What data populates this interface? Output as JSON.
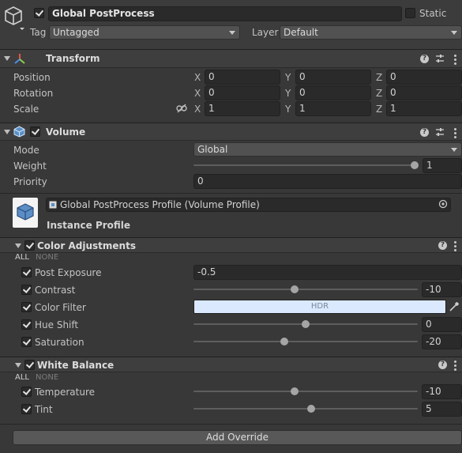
{
  "gameobject": {
    "name": "Global PostProcess",
    "active": true,
    "static_label": "Static",
    "tag_label": "Tag",
    "tag_value": "Untagged",
    "layer_label": "Layer",
    "layer_value": "Default"
  },
  "transform": {
    "title": "Transform",
    "rows": [
      {
        "label": "Position",
        "x": "0",
        "y": "0",
        "z": "0"
      },
      {
        "label": "Rotation",
        "x": "0",
        "y": "0",
        "z": "0"
      },
      {
        "label": "Scale",
        "x": "1",
        "y": "1",
        "z": "1"
      }
    ],
    "axis_x": "X",
    "axis_y": "Y",
    "axis_z": "Z"
  },
  "volume": {
    "title": "Volume",
    "enabled": true,
    "mode_label": "Mode",
    "mode_value": "Global",
    "weight_label": "Weight",
    "weight_value": "1",
    "weight_fraction": 1.0,
    "priority_label": "Priority",
    "priority_value": "0",
    "profile_value": "Global PostProcess  Profile (Volume Profile)",
    "instance_profile_label": "Instance Profile"
  },
  "color_adjustments": {
    "title": "Color Adjustments",
    "all_label": "ALL",
    "none_label": "NONE",
    "post_exposure_label": "Post Exposure",
    "post_exposure_value": "-0.5",
    "contrast_label": "Contrast",
    "contrast_value": "-10",
    "contrast_fraction": 0.45,
    "color_filter_label": "Color Filter",
    "color_filter_hdr": "HDR",
    "color_filter_color": "#dbe9ff",
    "hue_shift_label": "Hue Shift",
    "hue_shift_value": "0",
    "hue_shift_fraction": 0.5,
    "saturation_label": "Saturation",
    "saturation_value": "-20",
    "saturation_fraction": 0.4
  },
  "white_balance": {
    "title": "White Balance",
    "all_label": "ALL",
    "none_label": "NONE",
    "temperature_label": "Temperature",
    "temperature_value": "-10",
    "temperature_fraction": 0.45,
    "tint_label": "Tint",
    "tint_value": "5",
    "tint_fraction": 0.525
  },
  "add_override_label": "Add Override",
  "colors": {
    "background": "#383838",
    "header": "#3e3e3e",
    "field": "#2a2a2a",
    "transform_icon_red": "#e0564a",
    "transform_icon_green": "#8ccf49",
    "transform_icon_blue": "#4a8ef0"
  }
}
